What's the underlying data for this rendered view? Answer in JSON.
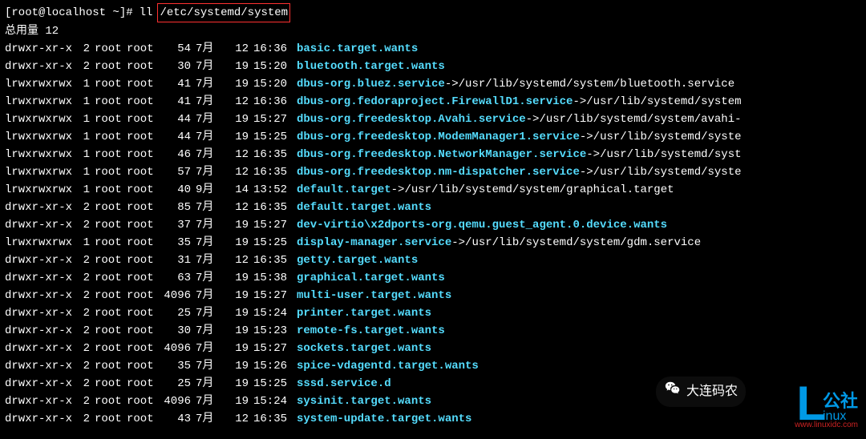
{
  "prompt": {
    "user": "[root@localhost ~]#",
    "command": "ll",
    "path": "/etc/systemd/system"
  },
  "total": "总用量 12",
  "rows": [
    {
      "perms": "drwxr-xr-x",
      "links": "2",
      "owner": "root",
      "group": "root",
      "size": "54",
      "mon": "7月",
      "day": "12",
      "time": "16:36",
      "name": "basic.target.wants",
      "arrow": "",
      "target": ""
    },
    {
      "perms": "drwxr-xr-x",
      "links": "2",
      "owner": "root",
      "group": "root",
      "size": "30",
      "mon": "7月",
      "day": "19",
      "time": "15:20",
      "name": "bluetooth.target.wants",
      "arrow": "",
      "target": ""
    },
    {
      "perms": "lrwxrwxrwx",
      "links": "1",
      "owner": "root",
      "group": "root",
      "size": "41",
      "mon": "7月",
      "day": "19",
      "time": "15:20",
      "name": "dbus-org.bluez.service",
      "arrow": " -> ",
      "target": "/usr/lib/systemd/system/bluetooth.service"
    },
    {
      "perms": "lrwxrwxrwx",
      "links": "1",
      "owner": "root",
      "group": "root",
      "size": "41",
      "mon": "7月",
      "day": "12",
      "time": "16:36",
      "name": "dbus-org.fedoraproject.FirewallD1.service",
      "arrow": " -> ",
      "target": "/usr/lib/systemd/system"
    },
    {
      "perms": "lrwxrwxrwx",
      "links": "1",
      "owner": "root",
      "group": "root",
      "size": "44",
      "mon": "7月",
      "day": "19",
      "time": "15:27",
      "name": "dbus-org.freedesktop.Avahi.service",
      "arrow": " -> ",
      "target": "/usr/lib/systemd/system/avahi-"
    },
    {
      "perms": "lrwxrwxrwx",
      "links": "1",
      "owner": "root",
      "group": "root",
      "size": "44",
      "mon": "7月",
      "day": "19",
      "time": "15:25",
      "name": "dbus-org.freedesktop.ModemManager1.service",
      "arrow": " -> ",
      "target": "/usr/lib/systemd/syste"
    },
    {
      "perms": "lrwxrwxrwx",
      "links": "1",
      "owner": "root",
      "group": "root",
      "size": "46",
      "mon": "7月",
      "day": "12",
      "time": "16:35",
      "name": "dbus-org.freedesktop.NetworkManager.service",
      "arrow": " -> ",
      "target": "/usr/lib/systemd/syst"
    },
    {
      "perms": "lrwxrwxrwx",
      "links": "1",
      "owner": "root",
      "group": "root",
      "size": "57",
      "mon": "7月",
      "day": "12",
      "time": "16:35",
      "name": "dbus-org.freedesktop.nm-dispatcher.service",
      "arrow": " -> ",
      "target": "/usr/lib/systemd/syste"
    },
    {
      "perms": "lrwxrwxrwx",
      "links": "1",
      "owner": "root",
      "group": "root",
      "size": "40",
      "mon": "9月",
      "day": "14",
      "time": "13:52",
      "name": "default.target",
      "arrow": " -> ",
      "target": "/usr/lib/systemd/system/graphical.target"
    },
    {
      "perms": "drwxr-xr-x",
      "links": "2",
      "owner": "root",
      "group": "root",
      "size": "85",
      "mon": "7月",
      "day": "12",
      "time": "16:35",
      "name": "default.target.wants",
      "arrow": "",
      "target": ""
    },
    {
      "perms": "drwxr-xr-x",
      "links": "2",
      "owner": "root",
      "group": "root",
      "size": "37",
      "mon": "7月",
      "day": "19",
      "time": "15:27",
      "name": "dev-virtio\\x2dports-org.qemu.guest_agent.0.device.wants",
      "arrow": "",
      "target": ""
    },
    {
      "perms": "lrwxrwxrwx",
      "links": "1",
      "owner": "root",
      "group": "root",
      "size": "35",
      "mon": "7月",
      "day": "19",
      "time": "15:25",
      "name": "display-manager.service",
      "arrow": " -> ",
      "target": "/usr/lib/systemd/system/gdm.service"
    },
    {
      "perms": "drwxr-xr-x",
      "links": "2",
      "owner": "root",
      "group": "root",
      "size": "31",
      "mon": "7月",
      "day": "12",
      "time": "16:35",
      "name": "getty.target.wants",
      "arrow": "",
      "target": ""
    },
    {
      "perms": "drwxr-xr-x",
      "links": "2",
      "owner": "root",
      "group": "root",
      "size": "63",
      "mon": "7月",
      "day": "19",
      "time": "15:38",
      "name": "graphical.target.wants",
      "arrow": "",
      "target": ""
    },
    {
      "perms": "drwxr-xr-x",
      "links": "2",
      "owner": "root",
      "group": "root",
      "size": "4096",
      "mon": "7月",
      "day": "19",
      "time": "15:27",
      "name": "multi-user.target.wants",
      "arrow": "",
      "target": ""
    },
    {
      "perms": "drwxr-xr-x",
      "links": "2",
      "owner": "root",
      "group": "root",
      "size": "25",
      "mon": "7月",
      "day": "19",
      "time": "15:24",
      "name": "printer.target.wants",
      "arrow": "",
      "target": ""
    },
    {
      "perms": "drwxr-xr-x",
      "links": "2",
      "owner": "root",
      "group": "root",
      "size": "30",
      "mon": "7月",
      "day": "19",
      "time": "15:23",
      "name": "remote-fs.target.wants",
      "arrow": "",
      "target": ""
    },
    {
      "perms": "drwxr-xr-x",
      "links": "2",
      "owner": "root",
      "group": "root",
      "size": "4096",
      "mon": "7月",
      "day": "19",
      "time": "15:27",
      "name": "sockets.target.wants",
      "arrow": "",
      "target": ""
    },
    {
      "perms": "drwxr-xr-x",
      "links": "2",
      "owner": "root",
      "group": "root",
      "size": "35",
      "mon": "7月",
      "day": "19",
      "time": "15:26",
      "name": "spice-vdagentd.target.wants",
      "arrow": "",
      "target": ""
    },
    {
      "perms": "drwxr-xr-x",
      "links": "2",
      "owner": "root",
      "group": "root",
      "size": "25",
      "mon": "7月",
      "day": "19",
      "time": "15:25",
      "name": "sssd.service.d",
      "arrow": "",
      "target": ""
    },
    {
      "perms": "drwxr-xr-x",
      "links": "2",
      "owner": "root",
      "group": "root",
      "size": "4096",
      "mon": "7月",
      "day": "19",
      "time": "15:24",
      "name": "sysinit.target.wants",
      "arrow": "",
      "target": ""
    },
    {
      "perms": "drwxr-xr-x",
      "links": "2",
      "owner": "root",
      "group": "root",
      "size": "43",
      "mon": "7月",
      "day": "12",
      "time": "16:35",
      "name": "system-update.target.wants",
      "arrow": "",
      "target": ""
    }
  ],
  "watermark": {
    "wechat_label": "大连码农",
    "logo_big": "L",
    "logo_top": "公社",
    "logo_small": "inux",
    "url": "www.linuxidc.com"
  }
}
